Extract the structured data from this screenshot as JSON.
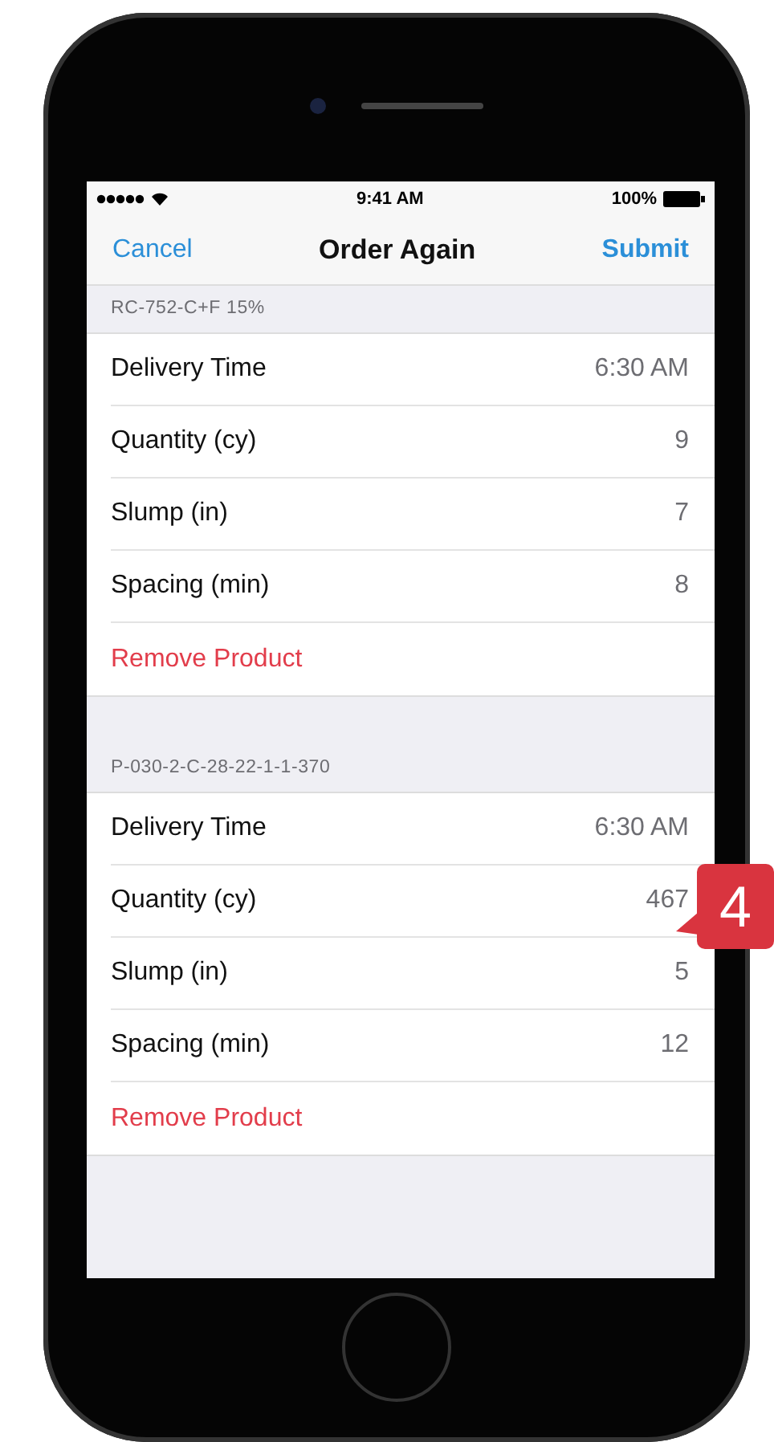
{
  "status_bar": {
    "time": "9:41 AM",
    "battery": "100%"
  },
  "nav": {
    "cancel": "Cancel",
    "title": "Order Again",
    "submit": "Submit"
  },
  "products": [
    {
      "code": "RC-752-C+F 15%",
      "fields": [
        {
          "label": "Delivery Time",
          "value": "6:30 AM"
        },
        {
          "label": "Quantity (cy)",
          "value": "9"
        },
        {
          "label": "Slump (in)",
          "value": "7"
        },
        {
          "label": "Spacing (min)",
          "value": "8"
        }
      ],
      "remove": "Remove Product"
    },
    {
      "code": "P-030-2-C-28-22-1-1-370",
      "fields": [
        {
          "label": "Delivery Time",
          "value": "6:30 AM"
        },
        {
          "label": "Quantity (cy)",
          "value": "467"
        },
        {
          "label": "Slump (in)",
          "value": "5"
        },
        {
          "label": "Spacing (min)",
          "value": "12"
        }
      ],
      "remove": "Remove Product"
    }
  ],
  "callout": {
    "label": "4"
  }
}
